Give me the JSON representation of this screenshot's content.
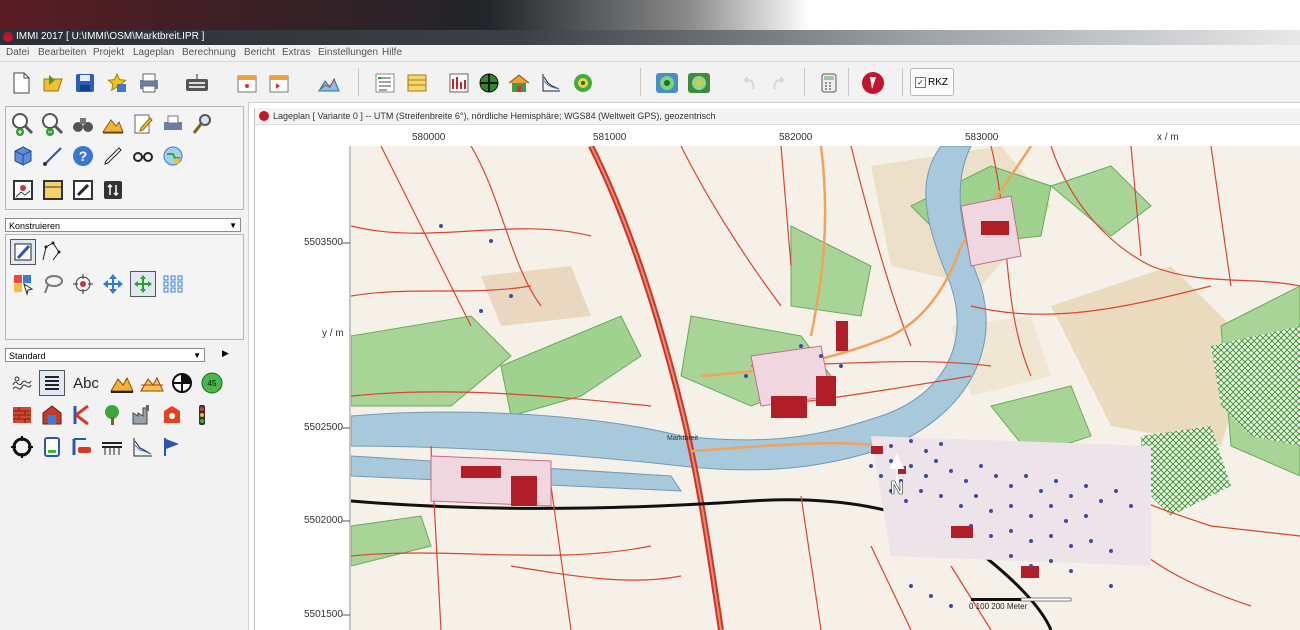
{
  "window": {
    "title": "IMMI 2017 [ U:\\IMMI\\OSM\\Marktbreit.IPR ]"
  },
  "menu": [
    "Datei",
    "Bearbeiten",
    "Projekt",
    "Lageplan",
    "Berechnung",
    "Bericht",
    "Extras",
    "Einstellungen",
    "Hilfe"
  ],
  "toolbar": {
    "icons": [
      "new-file-icon",
      "open-icon",
      "save-icon",
      "favorites-icon",
      "print-icon",
      "keyboard-icon",
      "calendar-icon",
      "export-icon",
      "chart-icon",
      "list-icon",
      "table-icon",
      "ruler-icon",
      "crosshair-icon",
      "house-icon",
      "graph-icon",
      "target-icon",
      "sound-level-icon",
      "grid-sound-icon",
      "undo-icon",
      "redo-icon",
      "calculator-icon",
      "immi-logo-icon"
    ],
    "rkz_label": "RKZ",
    "rkz_checked": true
  },
  "left_panel": {
    "construct_dropdown": "Konstruieren",
    "standard_dropdown": "Standard",
    "abc_label": "Abc",
    "speed_label": "45"
  },
  "map_window": {
    "title": "Lageplan  [ Variante 0 ]  --  UTM (Streifenbreite 6°), nördliche Hemisphäre; WGS84 (Weltweit GPS), geozentrisch",
    "x_ticks": [
      "580000",
      "581000",
      "582000",
      "583000"
    ],
    "x_axis_label": "x / m",
    "y_ticks": [
      "5503500",
      "5502500",
      "5502000",
      "5501500"
    ],
    "y_axis_label": "y / m",
    "scale_label": "0   100  200 Meter",
    "north_label": "N",
    "place_label": "Marktbreit"
  },
  "colors": {
    "accent": "#c0152d",
    "river": "#a8c8dc",
    "forest": "#9fd28e",
    "road": "#d9452f",
    "building": "#b01e28"
  }
}
